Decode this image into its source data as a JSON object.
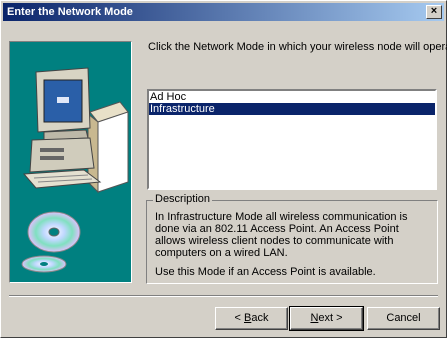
{
  "window": {
    "title": "Enter the Network Mode",
    "close_symbol": "×"
  },
  "instruction": "Click the Network Mode in which your wireless node will operate.",
  "modes": [
    {
      "label": "Ad Hoc",
      "selected": false
    },
    {
      "label": "Infrastructure",
      "selected": true
    }
  ],
  "description": {
    "legend": "Description",
    "text": "In Infrastructure Mode all wireless communication is done via an 802.11 Access Point.  An Access Point allows wireless client nodes to communicate with computers on a wired LAN.",
    "note": "Use this Mode if an Access Point is available."
  },
  "buttons": {
    "back_prefix": "< ",
    "back_key": "B",
    "back_rest": "ack",
    "next_key": "N",
    "next_rest": "ext >",
    "cancel": "Cancel"
  },
  "icons": [
    "computer-icon",
    "cd-disc-icon"
  ]
}
